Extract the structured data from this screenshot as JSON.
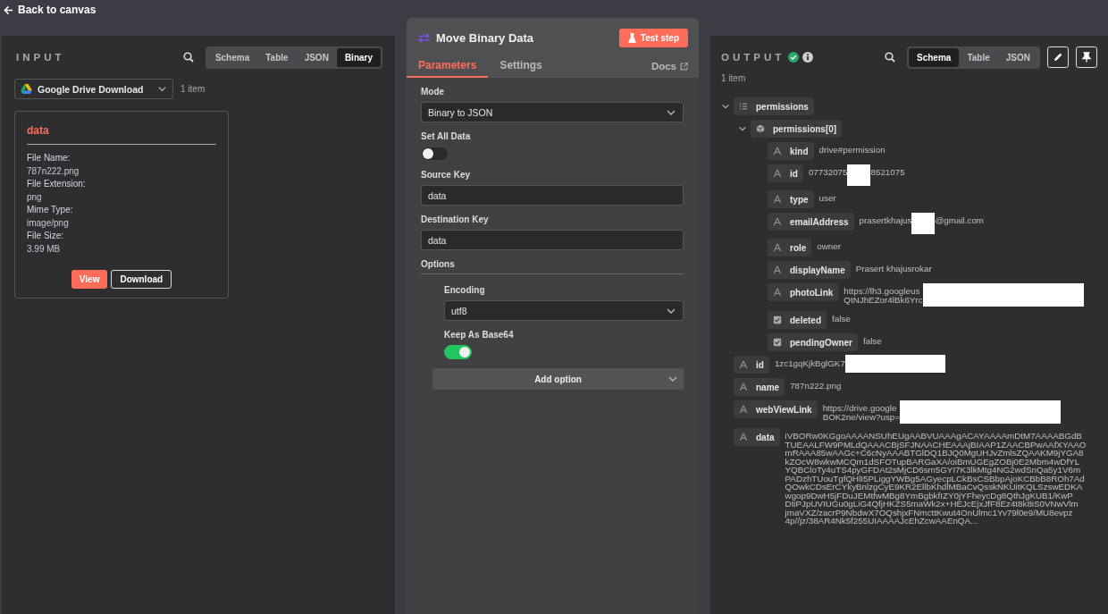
{
  "back_link": {
    "label": "Back to canvas"
  },
  "input": {
    "title": "INPUT",
    "tabs": [
      {
        "label": "Schema",
        "selected": false
      },
      {
        "label": "Table",
        "selected": false
      },
      {
        "label": "JSON",
        "selected": false
      },
      {
        "label": "Binary",
        "selected": true
      }
    ],
    "node_select": {
      "value": "Google Drive Download"
    },
    "item_count": "1 item",
    "binary": {
      "title": "data",
      "fields": [
        {
          "label": "File Name:",
          "value": "787n222.png"
        },
        {
          "label": "File Extension:",
          "value": "png"
        },
        {
          "label": "Mime Type:",
          "value": "image/png"
        },
        {
          "label": "File Size:",
          "value": "3.99 MB"
        }
      ],
      "buttons": [
        {
          "label": "View",
          "kind": "primary"
        },
        {
          "label": "Download",
          "kind": "outline"
        }
      ]
    }
  },
  "node": {
    "title": "Move Binary Data",
    "test_button": "Test step",
    "tabs": [
      {
        "label": "Parameters",
        "selected": true
      },
      {
        "label": "Settings",
        "selected": false
      }
    ],
    "docs_link": "Docs",
    "params": [
      {
        "kind": "select",
        "label": "Mode",
        "value": "Binary to JSON"
      },
      {
        "kind": "toggle",
        "label": "Set All Data",
        "on": false
      },
      {
        "kind": "input",
        "label": "Source Key",
        "value": "data"
      },
      {
        "kind": "input",
        "label": "Destination Key",
        "value": "data"
      }
    ],
    "options": {
      "title": "Options",
      "items": [
        {
          "kind": "select",
          "label": "Encoding",
          "value": "utf8"
        },
        {
          "kind": "toggle",
          "label": "Keep As Base64",
          "on": true
        }
      ],
      "add_button": "Add option"
    }
  },
  "output": {
    "title": "OUTPUT",
    "tabs": [
      {
        "label": "Schema",
        "selected": true
      },
      {
        "label": "Table",
        "selected": false
      },
      {
        "label": "JSON",
        "selected": false
      }
    ],
    "item_count": "1 item",
    "schema": [
      {
        "kind": "array",
        "key": "permissions",
        "expanded": true,
        "children": [
          {
            "kind": "object",
            "key": "permissions[0]",
            "expanded": true,
            "children": [
              {
                "kind": "string",
                "key": "kind",
                "value": [
                  {
                    "kind": "text",
                    "lines": [
                      "drive#permission"
                    ]
                  }
                ]
              },
              {
                "kind": "string",
                "key": "id",
                "value": [
                  {
                    "kind": "text",
                    "lines": [
                      "07732075"
                    ]
                  },
                  {
                    "kind": "redacted_small"
                  },
                  {
                    "kind": "text",
                    "lines": [
                      "8521075"
                    ]
                  }
                ]
              },
              {
                "kind": "string",
                "key": "type",
                "value": [
                  {
                    "kind": "text",
                    "lines": [
                      "user"
                    ]
                  }
                ]
              },
              {
                "kind": "string",
                "key": "emailAddress",
                "value": [
                  {
                    "kind": "text",
                    "lines": [
                      "prasertkhajus"
                    ]
                  },
                  {
                    "kind": "redacted_small"
                  },
                  {
                    "kind": "text",
                    "lines": [
                      "@gmail.com"
                    ]
                  }
                ]
              },
              {
                "kind": "string",
                "key": "role",
                "value": [
                  {
                    "kind": "text",
                    "lines": [
                      "owner"
                    ]
                  }
                ]
              },
              {
                "kind": "string",
                "key": "displayName",
                "value": [
                  {
                    "kind": "text",
                    "lines": [
                      "Prasert khajusrokar"
                    ]
                  }
                ]
              },
              {
                "kind": "string",
                "key": "photoLink",
                "value": [
                  {
                    "kind": "text",
                    "lines": [
                      "https://lh3.googleus",
                      "QtNJhEZor4lBk6Yrc"
                    ]
                  },
                  {
                    "kind": "redacted_large"
                  }
                ]
              },
              {
                "kind": "boolean",
                "key": "deleted",
                "value": [
                  {
                    "kind": "text",
                    "lines": [
                      "false"
                    ]
                  }
                ]
              },
              {
                "kind": "boolean",
                "key": "pendingOwner",
                "value": [
                  {
                    "kind": "text",
                    "lines": [
                      "false"
                    ]
                  }
                ]
              }
            ]
          }
        ]
      },
      {
        "kind": "string",
        "key": "id",
        "value": [
          {
            "kind": "text",
            "lines": [
              "1zc1gqKjkBglGK7"
            ]
          },
          {
            "kind": "redacted_medium"
          }
        ]
      },
      {
        "kind": "string",
        "key": "name",
        "value": [
          {
            "kind": "text",
            "lines": [
              "787n222.png"
            ]
          }
        ]
      },
      {
        "kind": "string",
        "key": "webViewLink",
        "value": [
          {
            "kind": "text",
            "lines": [
              "https://drive.google",
              "BOK2ne/view?usp="
            ]
          },
          {
            "kind": "redacted_large"
          }
        ]
      },
      {
        "kind": "string",
        "key": "data",
        "value": [
          {
            "kind": "text",
            "lines": [
              "iVBORw0KGgoAAAANSUhEUgAABVUAAAgACAYAAAAmDtM7AAAABGdB",
              "TUEAALFW9PMLdQAAACBjSFJNAACHEAAAjBIAAP1ZAACBPwAAfXYAAO",
              "mRAAA85wAAGc+C6cNyAAABTGlDQ1BJQ0MgUHJvZmlsZQAAKM9jYGA8",
              "kZOcW8wkwMCQm1dSFOTupBARGaXA/oiBmUGEgZOBj0E2Mbm4wDfYL",
              "YQBCloTy4uTS4pyGFDAt2sMjCD6sm5GYI7K3lkMtg4NG2wdSnQa5y1V6m",
              "PADzhTUouTgfQHlI5PLiggYWBg5AGyecpLCkBsCSBbpAjoKCBbB8ROh7Ad",
              "QOwkCDsErCYkyBnlzgCyE9KR2EllbKhdlMBaCvQsskNKUitKQLSzswEDKA",
              "wgop9DwH5jFDuJEMtfwMBg8YmBgbkfIZY0jYFheycDg8QthJgKUB1/KwP",
              "DtiPJpUVIUGu0gLiG4QfjHKZS5maWk2x+HEJcEjxJfF8Ez4t8k8iS0VNwVlm",
              "jmaVXZ/zacrP9NbdwX7OQshjxFNmcttKwut4OnUlmc1Yv79l0e9/MU8evpz",
              "4p//jz/38AR4Nk5f255UIAAAAJcEhZcwAAEnQA..."
            ]
          }
        ]
      }
    ]
  }
}
